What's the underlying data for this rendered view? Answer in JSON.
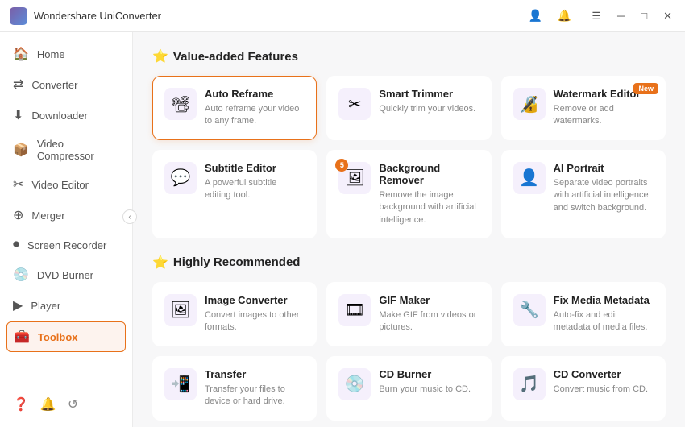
{
  "titlebar": {
    "logo_alt": "Wondershare UniConverter",
    "title": "Wondershare UniConverter"
  },
  "sidebar": {
    "items": [
      {
        "id": "home",
        "label": "Home",
        "icon": "🏠"
      },
      {
        "id": "converter",
        "label": "Converter",
        "icon": "⇄"
      },
      {
        "id": "downloader",
        "label": "Downloader",
        "icon": "⬇"
      },
      {
        "id": "video-compressor",
        "label": "Video Compressor",
        "icon": "📦"
      },
      {
        "id": "video-editor",
        "label": "Video Editor",
        "icon": "✂"
      },
      {
        "id": "merger",
        "label": "Merger",
        "icon": "⊕"
      },
      {
        "id": "screen-recorder",
        "label": "Screen Recorder",
        "icon": "⏺"
      },
      {
        "id": "dvd-burner",
        "label": "DVD Burner",
        "icon": "💿"
      },
      {
        "id": "player",
        "label": "Player",
        "icon": "▶"
      },
      {
        "id": "toolbox",
        "label": "Toolbox",
        "icon": "🧰",
        "active": true
      }
    ],
    "bottom_icons": [
      "?",
      "🔔",
      "↺"
    ]
  },
  "sections": [
    {
      "id": "value-added",
      "title": "Value-added Features",
      "features": [
        {
          "id": "auto-reframe",
          "title": "Auto Reframe",
          "desc": "Auto reframe your video to any frame.",
          "icon": "📽",
          "selected": true,
          "badge": null
        },
        {
          "id": "smart-trimmer",
          "title": "Smart Trimmer",
          "desc": "Quickly trim your videos.",
          "icon": "✂",
          "selected": false,
          "badge": null
        },
        {
          "id": "watermark-editor",
          "title": "Watermark Editor",
          "desc": "Remove or add watermarks.",
          "icon": "🔏",
          "selected": false,
          "badge": "New"
        },
        {
          "id": "subtitle-editor",
          "title": "Subtitle Editor",
          "desc": "A powerful subtitle editing tool.",
          "icon": "💬",
          "selected": false,
          "badge": null
        },
        {
          "id": "background-remover",
          "title": "Background Remover",
          "desc": "Remove the image background with artificial intelligence.",
          "icon": "🖼",
          "selected": false,
          "badge": "5"
        },
        {
          "id": "ai-portrait",
          "title": "AI Portrait",
          "desc": "Separate video portraits with artificial intelligence and switch background.",
          "icon": "👤",
          "selected": false,
          "badge": null
        }
      ]
    },
    {
      "id": "highly-recommended",
      "title": "Highly Recommended",
      "features": [
        {
          "id": "image-converter",
          "title": "Image Converter",
          "desc": "Convert images to other formats.",
          "icon": "🖼",
          "selected": false,
          "badge": null
        },
        {
          "id": "gif-maker",
          "title": "GIF Maker",
          "desc": "Make GIF from videos or pictures.",
          "icon": "🎞",
          "selected": false,
          "badge": null
        },
        {
          "id": "fix-media-metadata",
          "title": "Fix Media Metadata",
          "desc": "Auto-fix and edit metadata of media files.",
          "icon": "🔧",
          "selected": false,
          "badge": null
        },
        {
          "id": "transfer",
          "title": "Transfer",
          "desc": "Transfer your files to device or hard drive.",
          "icon": "📲",
          "selected": false,
          "badge": null
        },
        {
          "id": "cd-burner",
          "title": "CD Burner",
          "desc": "Burn your music to CD.",
          "icon": "💿",
          "selected": false,
          "badge": null
        },
        {
          "id": "cd-converter",
          "title": "CD Converter",
          "desc": "Convert music from CD.",
          "icon": "🎵",
          "selected": false,
          "badge": null
        }
      ]
    }
  ]
}
